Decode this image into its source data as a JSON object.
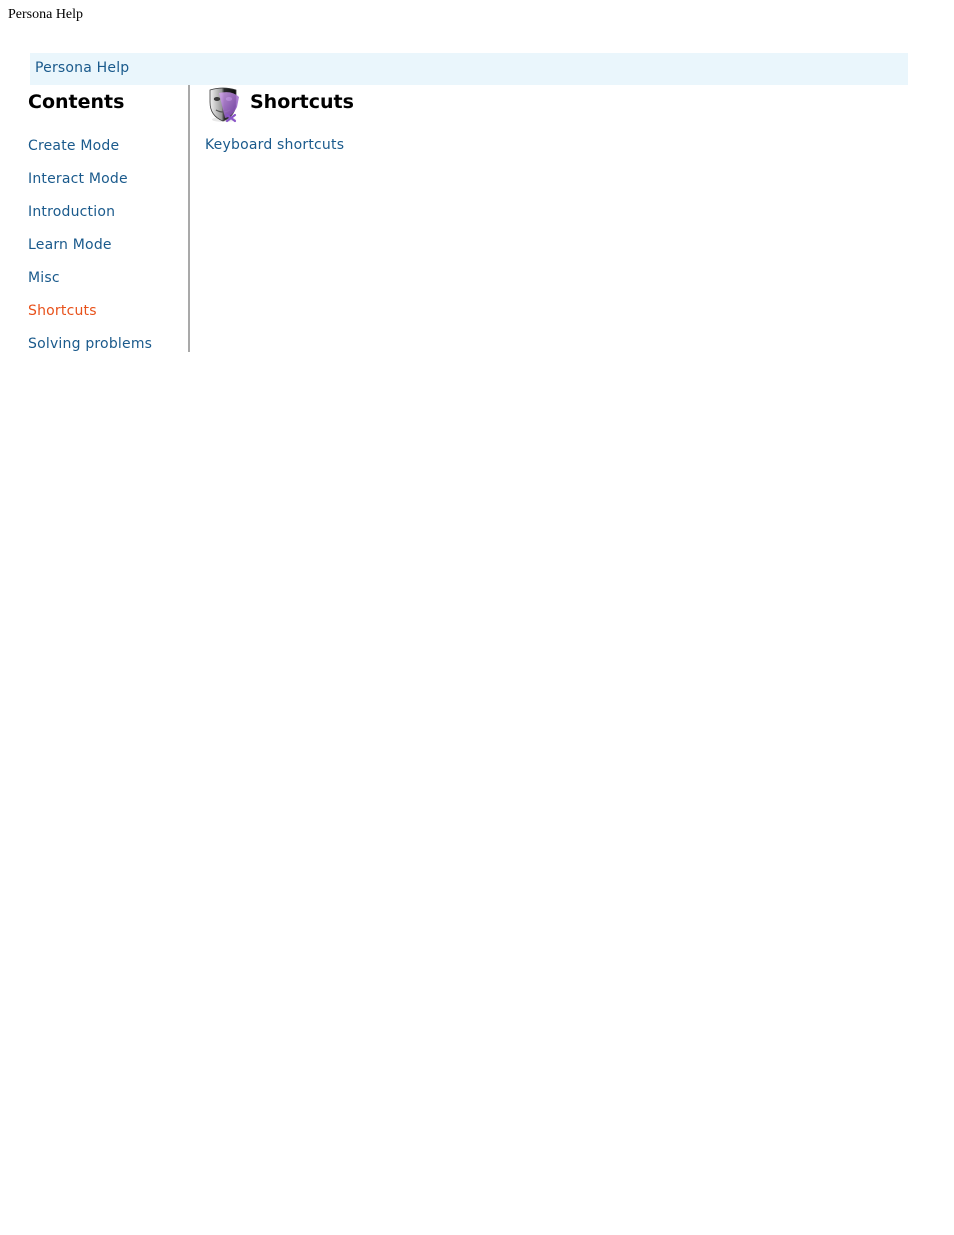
{
  "window": {
    "title": "Persona Help"
  },
  "breadcrumb": {
    "label": "Persona Help"
  },
  "sidebar": {
    "title": "Contents",
    "items": [
      {
        "label": "Create Mode"
      },
      {
        "label": "Interact Mode"
      },
      {
        "label": "Introduction"
      },
      {
        "label": "Learn Mode"
      },
      {
        "label": "Misc"
      },
      {
        "label": "Shortcuts",
        "active": true
      },
      {
        "label": "Solving problems"
      }
    ]
  },
  "main": {
    "icon": "theater-mask-icon",
    "title": "Shortcuts",
    "links": [
      {
        "label": "Keyboard shortcuts"
      }
    ]
  },
  "colors": {
    "link": "#1a5a8c",
    "active_link": "#e8511a",
    "breadcrumb_bg": "#eaf6fc",
    "divider": "#a9a9a9"
  }
}
